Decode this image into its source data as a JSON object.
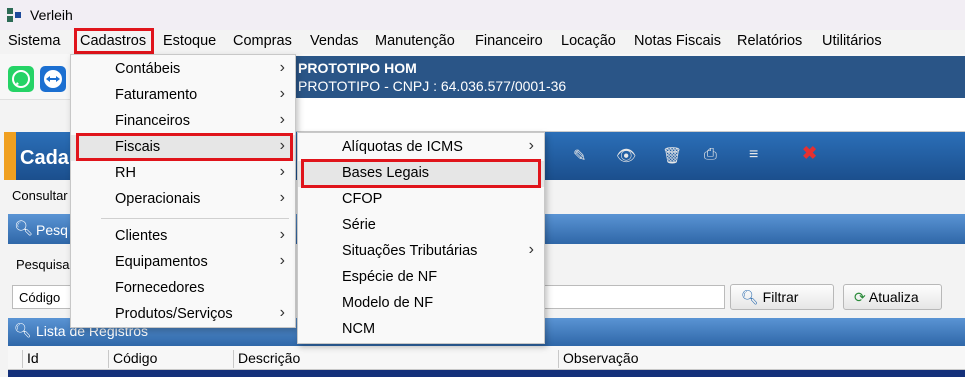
{
  "window": {
    "title": "Verleih"
  },
  "menubar": [
    "Sistema",
    "Cadastros",
    "Estoque",
    "Compras",
    "Vendas",
    "Manutenção",
    "Financeiro",
    "Locação",
    "Notas Fiscais",
    "Relatórios",
    "Utilitários"
  ],
  "company": {
    "name": "PROTOTIPO HOM",
    "info": "PROTOTIPO - CNPJ : 64.036.577/0001-36"
  },
  "header": {
    "title": "Cada"
  },
  "tabs": {
    "consultar": "Consultar"
  },
  "search": {
    "section_title": "Pesq",
    "label": "Pesquisa",
    "field_select": "Código",
    "filter_button": "Filtrar",
    "refresh_button": "Atualiza"
  },
  "list": {
    "section_title": "Lista de Registros",
    "columns": [
      "Id",
      "Código",
      "Descrição",
      "Observação"
    ]
  },
  "cadastros_menu": {
    "items": [
      "Contábeis",
      "Faturamento",
      "Financeiros",
      "Fiscais",
      "RH",
      "Operacionais",
      "Clientes",
      "Equipamentos",
      "Fornecedores",
      "Produtos/Serviços"
    ]
  },
  "fiscais_menu": {
    "items": [
      "Alíquotas de ICMS",
      "Bases Legais",
      "CFOP",
      "Série",
      "Situações Tributárias",
      "Espécie de NF",
      "Modelo de NF",
      "NCM"
    ]
  },
  "colors": {
    "highlight_red": "#e0141b",
    "header_blue": "#2a5587",
    "accent_orange": "#f0a020"
  }
}
